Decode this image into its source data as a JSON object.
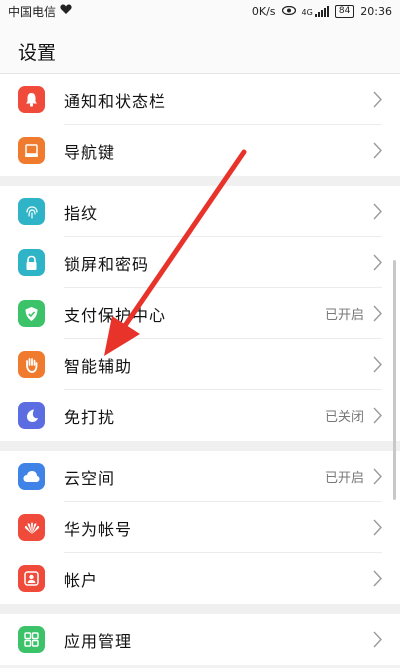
{
  "status_bar": {
    "carrier": "中国电信",
    "net_speed": "0K/s",
    "signal": "4G",
    "battery": "84",
    "time": "20:36",
    "icons": [
      "heart-icon",
      "eye-icon",
      "signal-icon",
      "battery-icon"
    ]
  },
  "header": {
    "title": "设置"
  },
  "groups": [
    {
      "items": [
        {
          "label": "通知和状态栏",
          "value": "",
          "icon": "bell-icon",
          "color": "#f04a3a"
        },
        {
          "label": "导航键",
          "value": "",
          "icon": "navigation-key-icon",
          "color": "#f07a2e"
        }
      ]
    },
    {
      "items": [
        {
          "label": "指纹",
          "value": "",
          "icon": "fingerprint-icon",
          "color": "#2fb3c6"
        },
        {
          "label": "锁屏和密码",
          "value": "",
          "icon": "lock-icon",
          "color": "#2fb3c6"
        },
        {
          "label": "支付保护中心",
          "value": "已开启",
          "icon": "shield-icon",
          "color": "#3cc36a"
        },
        {
          "label": "智能辅助",
          "value": "",
          "icon": "hand-icon",
          "color": "#f07a2e"
        },
        {
          "label": "免打扰",
          "value": "已关闭",
          "icon": "moon-icon",
          "color": "#5b6de0"
        }
      ]
    },
    {
      "items": [
        {
          "label": "云空间",
          "value": "已开启",
          "icon": "cloud-icon",
          "color": "#3f83e6"
        },
        {
          "label": "华为帐号",
          "value": "",
          "icon": "huawei-logo-icon",
          "color": "#f04a3a"
        },
        {
          "label": "帐户",
          "value": "",
          "icon": "account-icon",
          "color": "#f04a3a"
        }
      ]
    },
    {
      "items": [
        {
          "label": "应用管理",
          "value": "",
          "icon": "apps-grid-icon",
          "color": "#3cc36a"
        }
      ]
    }
  ],
  "annotation": {
    "color": "#e8332a"
  }
}
